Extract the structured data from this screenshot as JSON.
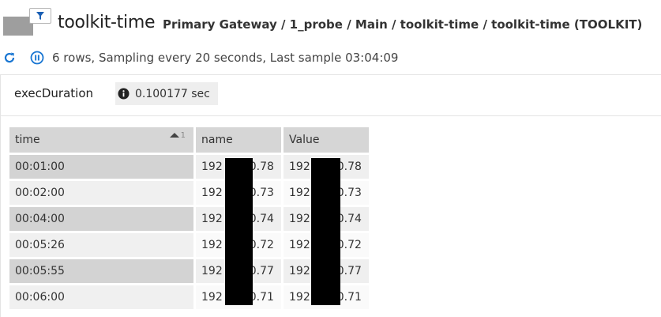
{
  "header": {
    "title": "toolkit-time",
    "breadcrumb": "Primary Gateway / 1_probe / Main / toolkit-time / toolkit-time (TOOLKIT)",
    "filter_icon": "filter-icon"
  },
  "status": {
    "text": "6 rows, Sampling every 20 seconds, Last sample 03:04:09",
    "refresh_icon": "refresh-icon",
    "pause_icon": "pause-icon",
    "accent_color": "#1976d2"
  },
  "field": {
    "label": "execDuration",
    "value": "0.100177 sec",
    "icon": "info-icon"
  },
  "table": {
    "columns": [
      "time",
      "name",
      "Value"
    ],
    "sort": {
      "column": "time",
      "direction": "ascending",
      "order": "1"
    },
    "rows": [
      {
        "time": "00:01:00",
        "name_prefix": "192",
        "name_suffix": "0.78",
        "value_prefix": "192",
        "value_suffix": "0.78"
      },
      {
        "time": "00:02:00",
        "name_prefix": "192",
        "name_suffix": "0.73",
        "value_prefix": "192",
        "value_suffix": "0.73"
      },
      {
        "time": "00:04:00",
        "name_prefix": "192",
        "name_suffix": "0.74",
        "value_prefix": "192",
        "value_suffix": "0.74"
      },
      {
        "time": "00:05:26",
        "name_prefix": "192",
        "name_suffix": "0.72",
        "value_prefix": "192",
        "value_suffix": "0.72"
      },
      {
        "time": "00:05:55",
        "name_prefix": "192",
        "name_suffix": "0.77",
        "value_prefix": "192",
        "value_suffix": "0.77"
      },
      {
        "time": "00:06:00",
        "name_prefix": "192",
        "name_suffix": "0.71",
        "value_prefix": "192",
        "value_suffix": "0.71"
      }
    ]
  }
}
